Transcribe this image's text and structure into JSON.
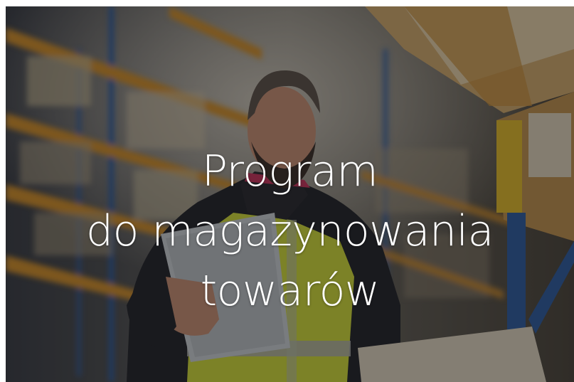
{
  "hero": {
    "title_lines": [
      "Program",
      "do magazynowania",
      "towarów"
    ],
    "image_subject": "warehouse-worker-with-tablet",
    "overlay_color": "#0a0a0c",
    "colors": {
      "background": "#2b2a27",
      "text": "#ffffff",
      "vest": "#c9d23a",
      "shelf_beam": "#c98a2a",
      "rack_blue": "#2f5a9a"
    }
  }
}
